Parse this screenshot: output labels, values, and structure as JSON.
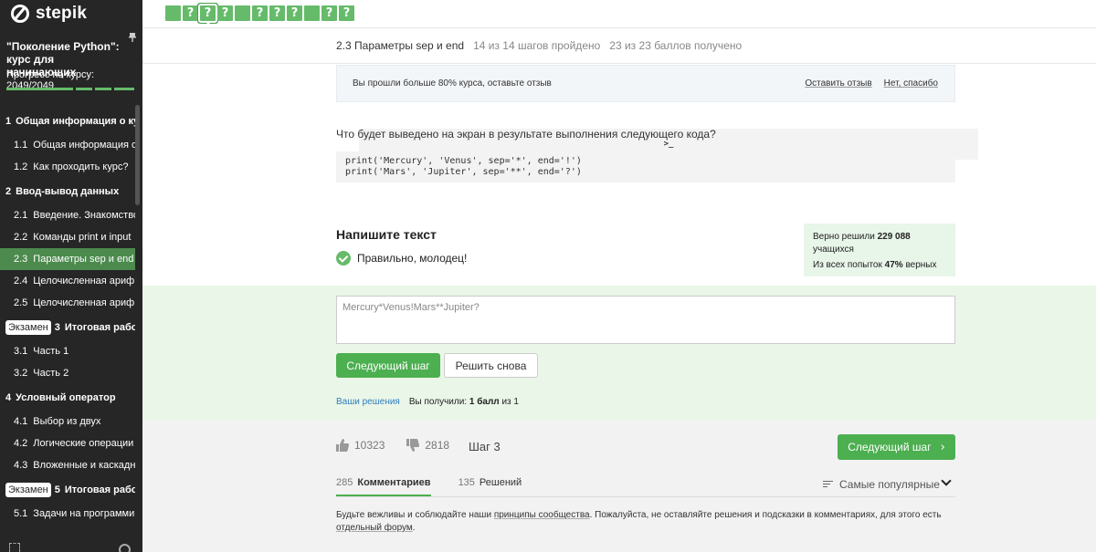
{
  "app": {
    "logo": "stepik"
  },
  "steps": [
    {
      "label": "",
      "kind": "text"
    },
    {
      "label": "?",
      "kind": "quiz"
    },
    {
      "label": "?",
      "kind": "quiz",
      "active": true
    },
    {
      "label": "?",
      "kind": "quiz"
    },
    {
      "label": ">_",
      "kind": "code"
    },
    {
      "label": ">_",
      "kind": "code"
    },
    {
      "label": ">_",
      "kind": "code"
    },
    {
      "label": "",
      "kind": "text"
    },
    {
      "label": "?",
      "kind": "quiz"
    },
    {
      "label": "?",
      "kind": "quiz"
    },
    {
      "label": "?",
      "kind": "quiz"
    },
    {
      "label": "",
      "kind": "text"
    },
    {
      "label": "?",
      "kind": "quiz"
    },
    {
      "label": "?",
      "kind": "quiz"
    }
  ],
  "sidebar": {
    "course_title": "\"Поколение Python\": курс для начинающих",
    "progress_label": "Прогресс по курсу:",
    "progress_value": "2049/2049",
    "items": [
      {
        "type": "section",
        "num": "1",
        "label": "Общая информация о ку..."
      },
      {
        "type": "item",
        "num": "1.1",
        "label": "Общая информация о ..."
      },
      {
        "type": "item",
        "num": "1.2",
        "label": "Как проходить курс?"
      },
      {
        "type": "section",
        "num": "2",
        "label": "Ввод-вывод данных"
      },
      {
        "type": "item",
        "num": "2.1",
        "label": "Введение. Знакомство ..."
      },
      {
        "type": "item",
        "num": "2.2",
        "label": "Команды print и input"
      },
      {
        "type": "item",
        "num": "2.3",
        "label": "Параметры sep и end",
        "active": true
      },
      {
        "type": "item",
        "num": "2.4",
        "label": "Целочисленная арифм..."
      },
      {
        "type": "item",
        "num": "2.5",
        "label": "Целочисленная арифм..."
      },
      {
        "type": "section",
        "num": "3",
        "label": "Итоговая работа...",
        "badge": "Экзамен"
      },
      {
        "type": "item",
        "num": "3.1",
        "label": "Часть 1"
      },
      {
        "type": "item",
        "num": "3.2",
        "label": "Часть 2"
      },
      {
        "type": "section",
        "num": "4",
        "label": "Условный оператор"
      },
      {
        "type": "item",
        "num": "4.1",
        "label": "Выбор из двух"
      },
      {
        "type": "item",
        "num": "4.2",
        "label": "Логические операции"
      },
      {
        "type": "item",
        "num": "4.3",
        "label": "Вложенные и каскадн..."
      },
      {
        "type": "section",
        "num": "5",
        "label": "Итоговая работа...",
        "badge": "Экзамен"
      },
      {
        "type": "item",
        "num": "5.1",
        "label": "Задачи на программир..."
      }
    ]
  },
  "lesson": {
    "title": "2.3 Параметры sep и end",
    "steps_passed": "14 из 14 шагов пройдено",
    "points": "23 из 23 баллов  получено"
  },
  "feedback": {
    "text": "Вы прошли больше 80% курса, оставьте отзыв",
    "leave_review": "Оставить отзыв",
    "no_thanks": "Нет, спасибо"
  },
  "question": "Что будет выведено на экран в результате выполнения следующего кода?",
  "code_lines": [
    "print('Mercury', 'Venus', sep='*', end='!')",
    "print('Mars', 'Jupiter', sep='**', end='?')"
  ],
  "answer": {
    "title": "Напишите текст",
    "correct_msg": "Правильно, молодец!",
    "value": "Mercury*Venus!Mars**Jupiter?",
    "next_button": "Следующий шаг",
    "retry_button": "Решить снова",
    "your_solutions": "Ваши решения",
    "score_prefix": "Вы получили:",
    "score_value": "1 балл",
    "score_suffix": "из 1"
  },
  "stats": {
    "solved_prefix": "Верно решили",
    "solved_count": "229 088",
    "solved_suffix": "учащихся",
    "attempts_prefix": "Из всех попыток",
    "attempts_pct": "47%",
    "attempts_suffix": "верных"
  },
  "footer": {
    "likes": "10323",
    "dislikes": "2818",
    "step_label": "Шаг 3",
    "next_button": "Следующий шаг",
    "tabs": [
      {
        "count": "285",
        "label": "Комментариев",
        "active": true
      },
      {
        "count": "135",
        "label": "Решений",
        "active": false
      }
    ],
    "sort_label": "Самые популярные",
    "rules_1": "Будьте вежливы и соблюдайте наши",
    "rules_link1": "принципы сообщества",
    "rules_2": ". Пожалуйста, не оставляйте решения и подсказки в комментариях, для этого есть",
    "rules_link2": "отдельный форум",
    "rules_3": "."
  },
  "colors": {
    "accent": "#4caf50",
    "sidebar_bg": "#262626",
    "success_bg": "#eaf6e8",
    "link": "#2f7dbd"
  }
}
